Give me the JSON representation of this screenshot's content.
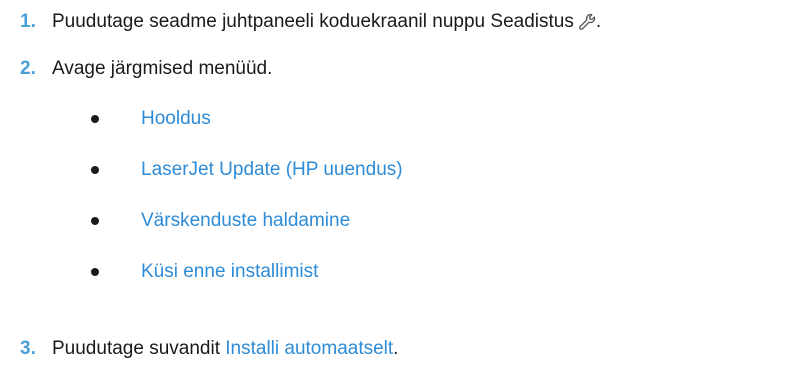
{
  "steps": [
    {
      "number": "1.",
      "text": "Puudutage seadme juhtpaneeli koduekraanil nuppu Seadistus",
      "icon": "wrench-icon",
      "suffix": "."
    },
    {
      "number": "2.",
      "text": "Avage järgmised menüüd."
    },
    {
      "number": "3.",
      "text_before": "Puudutage suvandit ",
      "link": "Installi automaatselt",
      "suffix": "."
    }
  ],
  "menu_path": [
    "Hooldus",
    "LaserJet Update (HP uuendus)",
    "Värskenduste haldamine",
    "Küsi enne installimist"
  ],
  "colors": {
    "step_number": "#4a9fd8",
    "link": "#2e8bd6",
    "text": "#1a1a1a"
  }
}
